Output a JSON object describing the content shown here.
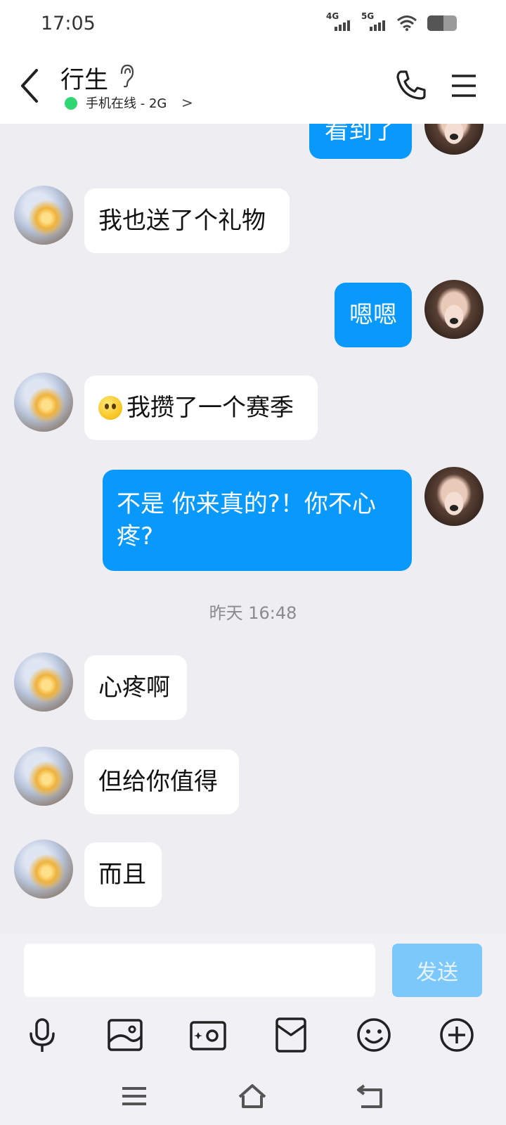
{
  "status": {
    "time": "17:05",
    "signal_1_label": "4G",
    "signal_2_label": "5G",
    "battery_level": 0.55
  },
  "header": {
    "contact_name": "行生",
    "online_status": "手机在线 - 2G",
    "chevron": ">"
  },
  "messages": [
    {
      "side": "right",
      "text": "看到了"
    },
    {
      "side": "left",
      "text": "我也送了个礼物"
    },
    {
      "side": "right",
      "text": "嗯嗯"
    },
    {
      "side": "left",
      "emoji": "smiley-face",
      "text": "我攒了一个赛季"
    },
    {
      "side": "right",
      "text": "不是 你来真的?！你不心疼?"
    },
    {
      "side": "left",
      "text": "心疼啊"
    },
    {
      "side": "left",
      "text": "但给你值得"
    },
    {
      "side": "left",
      "text": "而且"
    }
  ],
  "timestamp": "昨天 16:48",
  "input": {
    "placeholder": "",
    "send_label": "发送"
  },
  "toolbar_icons": [
    "microphone-icon",
    "picture-icon",
    "camera-icon",
    "red-packet-icon",
    "emoji-icon",
    "plus-icon"
  ],
  "colors": {
    "bubble_self": "#0999fb",
    "bubble_other": "#ffffff",
    "online": "#2fd672",
    "send_disabled": "#7cc8fb"
  }
}
